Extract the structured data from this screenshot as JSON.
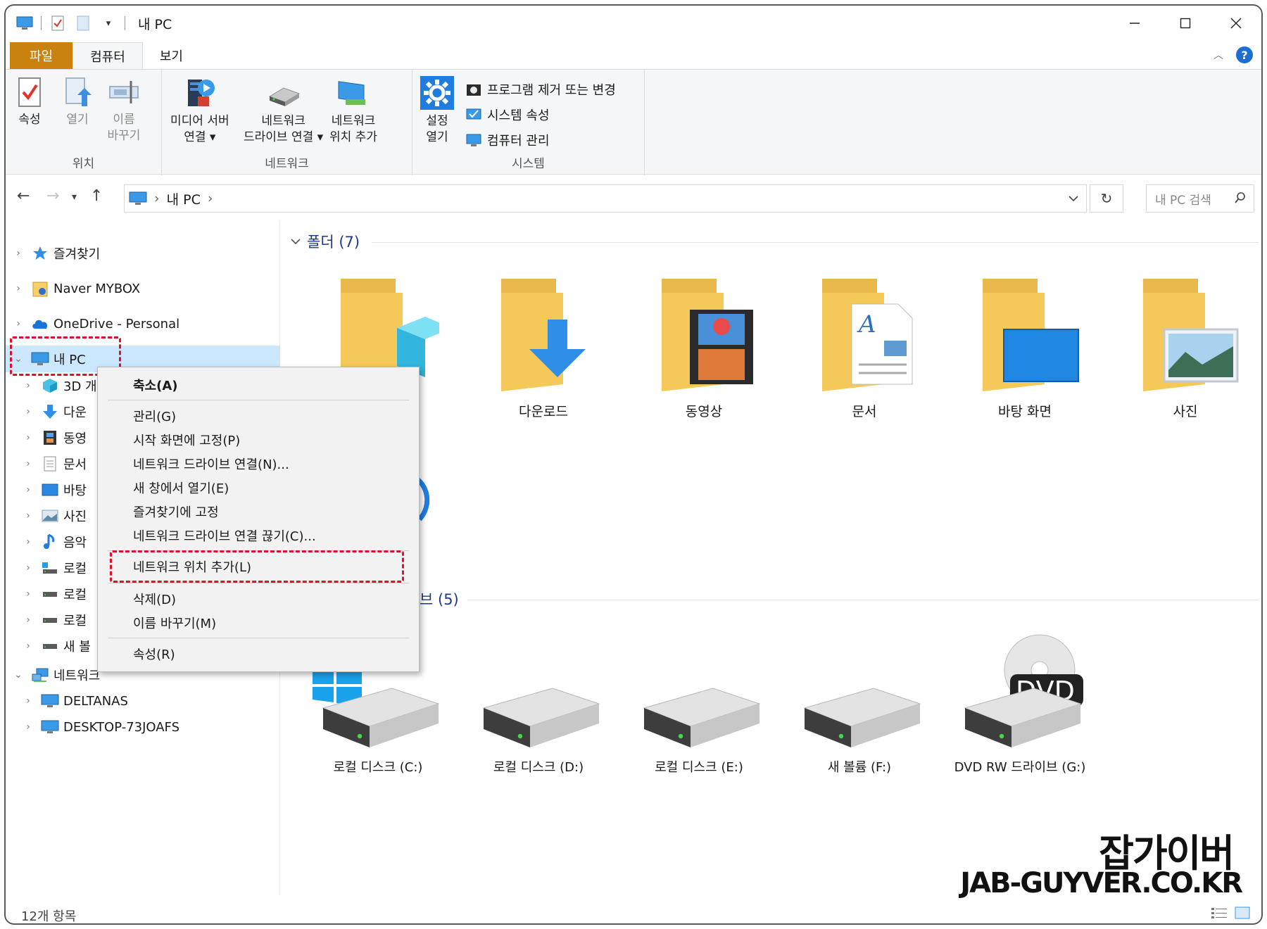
{
  "window": {
    "title": "내 PC"
  },
  "tabs": [
    {
      "label": "파일"
    },
    {
      "label": "컴퓨터"
    },
    {
      "label": "보기"
    }
  ],
  "ribbon": {
    "location": {
      "label": "위치",
      "properties": "속성",
      "open": "열기",
      "rename_line1": "이름",
      "rename_line2": "바꾸기"
    },
    "network": {
      "label": "네트워크",
      "media_line1": "미디어 서버",
      "media_line2": "연결",
      "map_line1": "네트워크",
      "map_line2": "드라이브 연결",
      "add_line1": "네트워크",
      "add_line2": "위치 추가"
    },
    "system": {
      "label": "시스템",
      "settings_line1": "설정",
      "settings_line2": "열기",
      "uninstall": "프로그램 제거 또는 변경",
      "props": "시스템 속성",
      "manage": "컴퓨터 관리"
    }
  },
  "address": {
    "crumb": "내 PC",
    "search_placeholder": "내 PC 검색"
  },
  "nav": {
    "favorites": "즐겨찾기",
    "mybox": "Naver MYBOX",
    "onedrive": "OneDrive - Personal",
    "thispc": "내 PC",
    "children": [
      {
        "label": "3D 개"
      },
      {
        "label": "다운"
      },
      {
        "label": "동영"
      },
      {
        "label": "문서"
      },
      {
        "label": "바탕"
      },
      {
        "label": "사진"
      },
      {
        "label": "음악"
      },
      {
        "label": "로컬"
      },
      {
        "label": "로컬"
      },
      {
        "label": "로컬"
      },
      {
        "label": "새 볼"
      }
    ],
    "network": "네트워크",
    "network_children": [
      {
        "label": "DELTANAS"
      },
      {
        "label": "DESKTOP-73JOAFS"
      }
    ]
  },
  "content": {
    "folders_header": "폴더 (7)",
    "drives_header_tail": "브 (5)",
    "folders": [
      {
        "name": ""
      },
      {
        "name": "다운로드"
      },
      {
        "name": "동영상"
      },
      {
        "name": "문서"
      },
      {
        "name": "바탕 화면"
      },
      {
        "name": "사진"
      }
    ],
    "drives": [
      {
        "name": "로컬 디스크 (C:)"
      },
      {
        "name": "로컬 디스크 (D:)"
      },
      {
        "name": "로컬 디스크 (E:)"
      },
      {
        "name": "새 볼륨 (F:)"
      },
      {
        "name": "DVD RW 드라이브 (G:)"
      }
    ]
  },
  "context_menu": {
    "collapse": "축소(A)",
    "manage": "관리(G)",
    "pin_start": "시작 화면에 고정(P)",
    "map_drive": "네트워크 드라이브 연결(N)...",
    "open_new": "새 창에서 열기(E)",
    "pin_quick": "즐겨찾기에 고정",
    "disconnect": "네트워크 드라이브 연결 끊기(C)...",
    "add_location": "네트워크 위치 추가(L)",
    "delete": "삭제(D)",
    "rename": "이름 바꾸기(M)",
    "properties": "속성(R)"
  },
  "status": {
    "count": "12개 항목"
  },
  "watermark": {
    "line1": "잡가이버",
    "line2": "JAB-GUYVER.CO.KR"
  },
  "colors": {
    "accent": "#1c6fd1",
    "file_tab": "#c9820f",
    "highlight": "#e0102a",
    "selected": "#cce8ff",
    "folder": "#f5c85a"
  }
}
